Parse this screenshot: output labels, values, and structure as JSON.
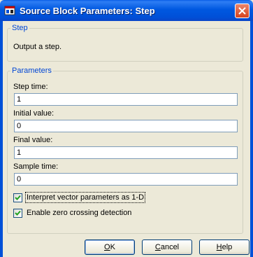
{
  "window": {
    "title": "Source Block Parameters: Step",
    "title_color": "#0050d8",
    "accent_color": "#0046d5"
  },
  "step_group": {
    "title": "Step",
    "description": "Output a step."
  },
  "params_group": {
    "title": "Parameters",
    "fields": [
      {
        "label": "Step time:",
        "value": "1"
      },
      {
        "label": "Initial value:",
        "value": "0"
      },
      {
        "label": "Final value:",
        "value": "1"
      },
      {
        "label": "Sample time:",
        "value": "0"
      }
    ],
    "checkboxes": [
      {
        "label": "Interpret vector parameters as 1-D",
        "checked": true
      },
      {
        "label": "Enable zero crossing detection",
        "checked": true
      }
    ]
  },
  "buttons": {
    "ok": "OK",
    "cancel": "Cancel",
    "help": "Help"
  },
  "icons": {
    "app": "simulink-block-icon",
    "close": "close-icon",
    "check": "checkmark-icon"
  }
}
